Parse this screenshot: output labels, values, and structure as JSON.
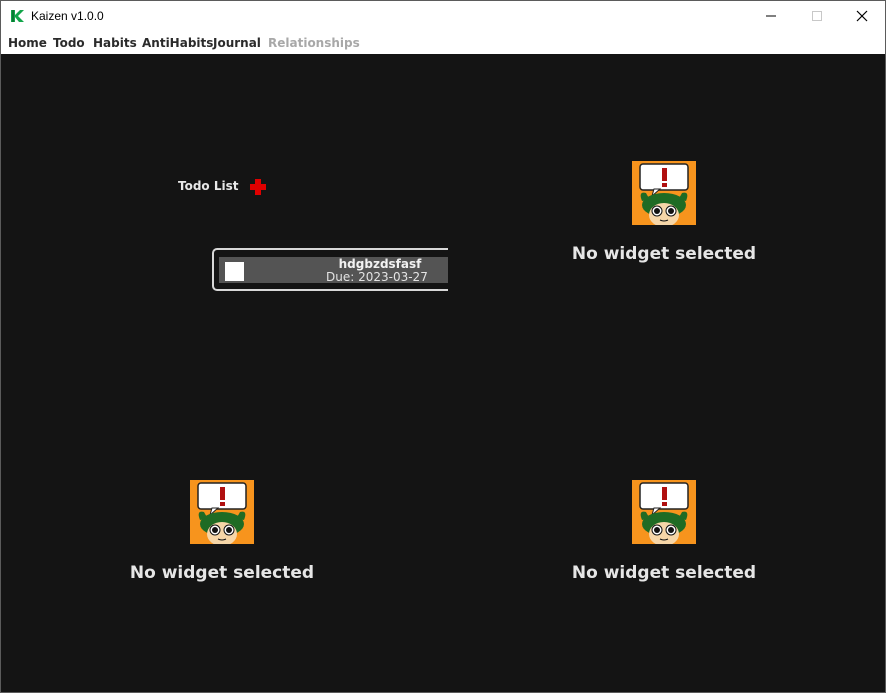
{
  "window": {
    "title": "Kaizen v1.0.0",
    "controls": {
      "minimize": "—",
      "maximize": "☐",
      "close": "✕"
    }
  },
  "menu": {
    "items": [
      {
        "label": "Home",
        "enabled": true
      },
      {
        "label": "Todo",
        "enabled": true
      },
      {
        "label": "Habits",
        "enabled": true
      },
      {
        "label": "AntiHabits",
        "enabled": true
      },
      {
        "label": "Journal",
        "enabled": true
      },
      {
        "label": "Relationships",
        "enabled": false
      }
    ]
  },
  "todo_widget": {
    "title": "Todo List",
    "add_icon": "plus-icon",
    "items": [
      {
        "name": "hdgbzdsfasf",
        "due": "Due: 2023-03-27",
        "checked": false
      }
    ]
  },
  "empty_widgets": [
    {
      "message": "No widget selected",
      "icon": "warning-character-icon"
    },
    {
      "message": "No widget selected",
      "icon": "warning-character-icon"
    },
    {
      "message": "No widget selected",
      "icon": "warning-character-icon"
    }
  ],
  "colors": {
    "background": "#141414",
    "accent_green": "#1db954",
    "add_red": "#e00000",
    "widget_orange": "#f7941d"
  }
}
